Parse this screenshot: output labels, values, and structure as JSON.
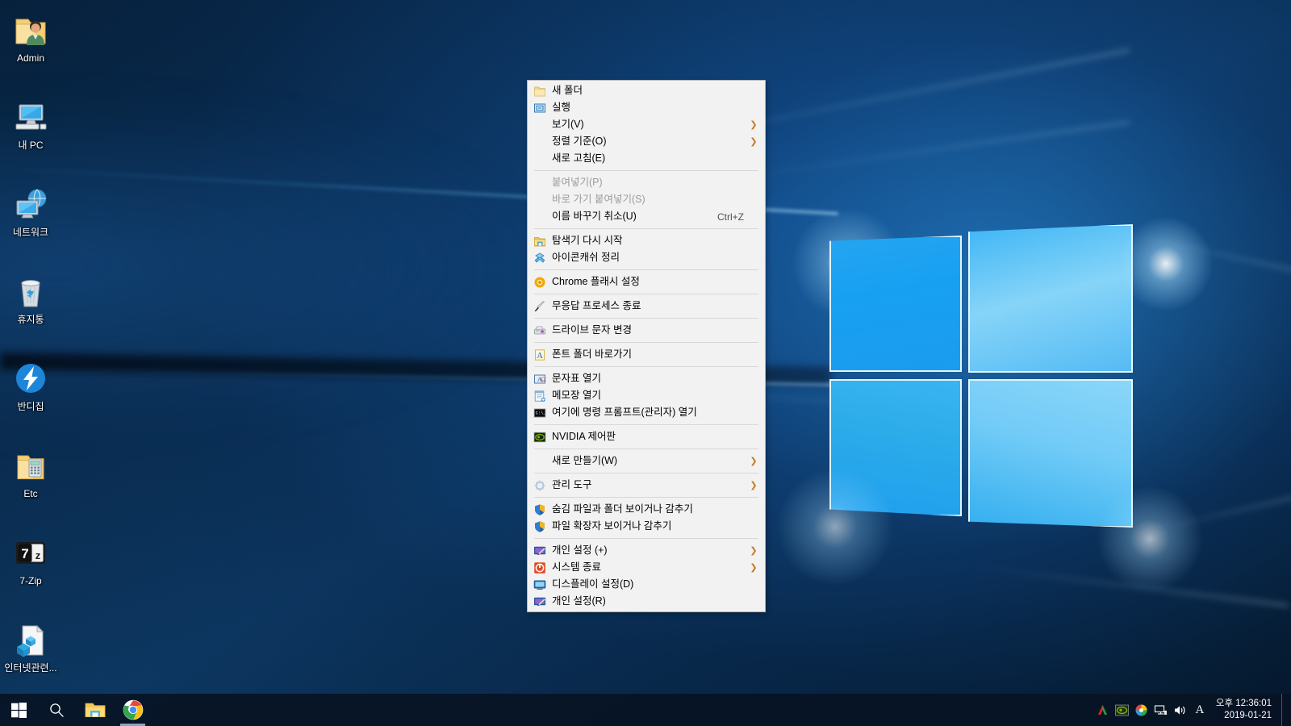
{
  "desktop": {
    "icons": [
      {
        "label": "Admin",
        "icon": "user-folder-icon"
      },
      {
        "label": "내 PC",
        "icon": "this-pc-icon"
      },
      {
        "label": "네트워크",
        "icon": "network-icon"
      },
      {
        "label": "휴지통",
        "icon": "recycle-bin-icon"
      },
      {
        "label": "반디집",
        "icon": "bandizip-icon"
      },
      {
        "label": "Etc",
        "icon": "folder-icon"
      },
      {
        "label": "7-Zip",
        "icon": "sevenzip-icon"
      },
      {
        "label": "인터넷관련...",
        "icon": "document-icon"
      }
    ]
  },
  "context_menu": {
    "items": [
      {
        "label": "새 폴더",
        "icon": "new-folder-icon",
        "type": "item",
        "arrow": false,
        "accel": ""
      },
      {
        "label": "실행",
        "icon": "run-icon",
        "type": "item",
        "arrow": false,
        "accel": ""
      },
      {
        "label": "보기(V)",
        "icon": "none",
        "type": "item",
        "arrow": true,
        "accel": ""
      },
      {
        "label": "정렬 기준(O)",
        "icon": "none",
        "type": "item",
        "arrow": true,
        "accel": ""
      },
      {
        "label": "새로 고침(E)",
        "icon": "none",
        "type": "item",
        "arrow": false,
        "accel": ""
      },
      {
        "type": "separator"
      },
      {
        "label": "붙여넣기(P)",
        "icon": "none",
        "type": "item",
        "arrow": false,
        "accel": "",
        "disabled": true
      },
      {
        "label": "바로 가기 붙여넣기(S)",
        "icon": "none",
        "type": "item",
        "arrow": false,
        "accel": "",
        "disabled": true
      },
      {
        "label": "이름 바꾸기 취소(U)",
        "icon": "none",
        "type": "item",
        "arrow": false,
        "accel": "Ctrl+Z"
      },
      {
        "type": "separator"
      },
      {
        "label": "탐색기 다시 시작",
        "icon": "explorer-icon",
        "type": "item",
        "arrow": false,
        "accel": ""
      },
      {
        "label": "아이콘캐쉬 정리",
        "icon": "iconcache-icon",
        "type": "item",
        "arrow": false,
        "accel": ""
      },
      {
        "type": "separator"
      },
      {
        "label": "Chrome 플래시 설정",
        "icon": "chrome-flash-icon",
        "type": "item",
        "arrow": false,
        "accel": ""
      },
      {
        "type": "separator"
      },
      {
        "label": "무응답 프로세스 종료",
        "icon": "knife-icon",
        "type": "item",
        "arrow": false,
        "accel": ""
      },
      {
        "type": "separator"
      },
      {
        "label": "드라이브 문자 변경",
        "icon": "drive-letter-icon",
        "type": "item",
        "arrow": false,
        "accel": ""
      },
      {
        "type": "separator"
      },
      {
        "label": "폰트 폴더 바로가기",
        "icon": "font-folder-icon",
        "type": "item",
        "arrow": false,
        "accel": ""
      },
      {
        "type": "separator"
      },
      {
        "label": "문자표 열기",
        "icon": "charmap-icon",
        "type": "item",
        "arrow": false,
        "accel": ""
      },
      {
        "label": "메모장 열기",
        "icon": "notepad-icon",
        "type": "item",
        "arrow": false,
        "accel": ""
      },
      {
        "label": "여기에 명령 프롬프트(관리자) 열기",
        "icon": "cmd-icon",
        "type": "item",
        "arrow": false,
        "accel": ""
      },
      {
        "type": "separator"
      },
      {
        "label": "NVIDIA 제어판",
        "icon": "nvidia-icon",
        "type": "item",
        "arrow": false,
        "accel": ""
      },
      {
        "type": "separator"
      },
      {
        "label": "새로 만들기(W)",
        "icon": "none",
        "type": "item",
        "arrow": true,
        "accel": ""
      },
      {
        "type": "separator"
      },
      {
        "label": "관리 도구",
        "icon": "admin-tools-icon",
        "type": "item",
        "arrow": true,
        "accel": ""
      },
      {
        "type": "separator"
      },
      {
        "label": "숨김 파일과 폴더 보이거나 감추기",
        "icon": "shield-icon",
        "type": "item",
        "arrow": false,
        "accel": ""
      },
      {
        "label": "파일 확장자 보이거나 감추기",
        "icon": "shield-icon",
        "type": "item",
        "arrow": false,
        "accel": ""
      },
      {
        "type": "separator"
      },
      {
        "label": "개인 설정 (+)",
        "icon": "personalize-icon",
        "type": "item",
        "arrow": true,
        "accel": ""
      },
      {
        "label": "시스템 종료",
        "icon": "shutdown-icon",
        "type": "item",
        "arrow": true,
        "accel": ""
      },
      {
        "label": "디스플레이 설정(D)",
        "icon": "display-icon",
        "type": "item",
        "arrow": false,
        "accel": ""
      },
      {
        "label": "개인 설정(R)",
        "icon": "personalize-icon",
        "type": "item",
        "arrow": false,
        "accel": ""
      }
    ]
  },
  "taskbar": {
    "start_label": "start-button",
    "search_label": "search-button",
    "apps": [
      {
        "name": "file-explorer",
        "running": false
      },
      {
        "name": "google-chrome",
        "running": true
      }
    ],
    "tray_icons": [
      "ahnlab-icon",
      "nvidia-icon",
      "realtek-audio-icon",
      "network-icon",
      "volume-icon",
      "ime-indicator"
    ],
    "ime_char": "A",
    "clock": {
      "time": "오후 12:36:01",
      "date": "2019-01-21"
    }
  },
  "colors": {
    "menu_bg": "#f2f2f2",
    "menu_border": "#b4b4b4",
    "separator": "#d7d7d7",
    "disabled_text": "#9b9b9b",
    "arrow": "#c77a28",
    "taskbar_bg": "#071324",
    "accent": "#0078d7"
  }
}
